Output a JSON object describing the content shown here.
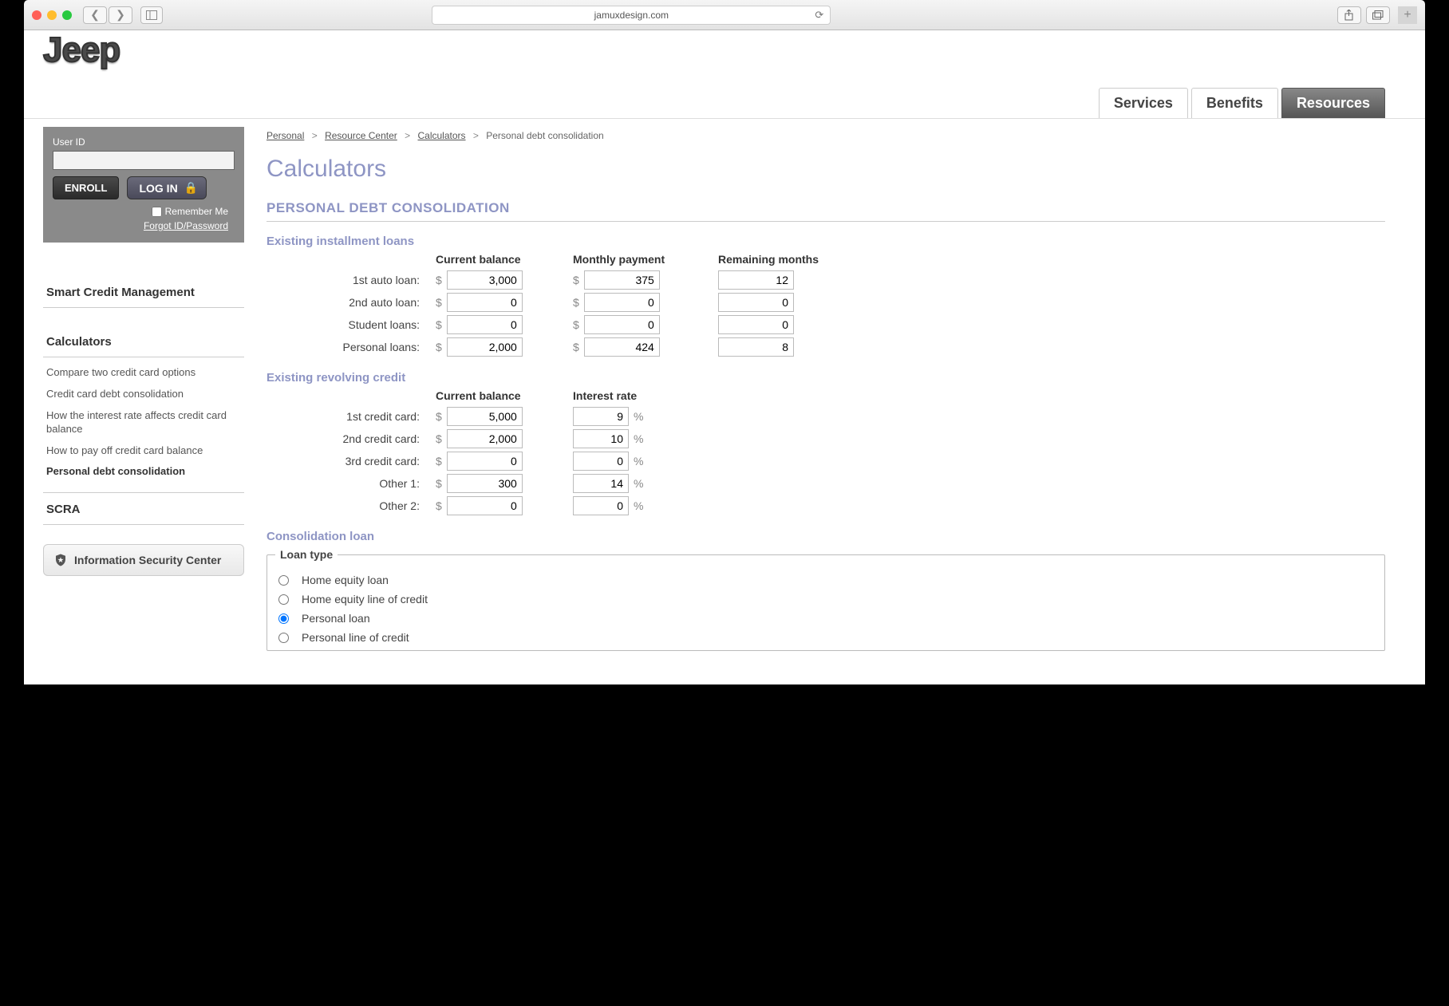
{
  "browser": {
    "url": "jamuxdesign.com"
  },
  "logo_text": "Jeep",
  "top_tabs": {
    "services": "Services",
    "benefits": "Benefits",
    "resources": "Resources"
  },
  "login": {
    "user_id_label": "User ID",
    "enroll": "ENROLL",
    "login": "LOG IN",
    "remember": "Remember Me",
    "forgot": "Forgot ID/Password"
  },
  "sidebar": {
    "smart_credit": "Smart Credit Management",
    "calculators_title": "Calculators",
    "links": [
      "Compare two credit card options",
      "Credit card debt consolidation",
      "How the interest rate affects credit card balance",
      "How to pay off credit card balance",
      "Personal debt consolidation"
    ],
    "scra": "SCRA",
    "isc": "Information Security Center"
  },
  "breadcrumb": {
    "personal": "Personal",
    "resource_center": "Resource Center",
    "calculators": "Calculators",
    "current": "Personal debt consolidation"
  },
  "page_title": "Calculators",
  "section_heading": "PERSONAL DEBT CONSOLIDATION",
  "installment": {
    "title": "Existing installment loans",
    "cols": {
      "balance": "Current balance",
      "monthly": "Monthly payment",
      "remaining": "Remaining months"
    },
    "rows": [
      {
        "label": "1st auto loan:",
        "balance": "3,000",
        "monthly": "375",
        "remaining": "12"
      },
      {
        "label": "2nd auto loan:",
        "balance": "0",
        "monthly": "0",
        "remaining": "0"
      },
      {
        "label": "Student loans:",
        "balance": "0",
        "monthly": "0",
        "remaining": "0"
      },
      {
        "label": "Personal loans:",
        "balance": "2,000",
        "monthly": "424",
        "remaining": "8"
      }
    ]
  },
  "revolving": {
    "title": "Existing revolving credit",
    "cols": {
      "balance": "Current balance",
      "rate": "Interest rate"
    },
    "rows": [
      {
        "label": "1st credit card:",
        "balance": "5,000",
        "rate": "9"
      },
      {
        "label": "2nd credit card:",
        "balance": "2,000",
        "rate": "10"
      },
      {
        "label": "3rd credit card:",
        "balance": "0",
        "rate": "0"
      },
      {
        "label": "Other 1:",
        "balance": "300",
        "rate": "14"
      },
      {
        "label": "Other 2:",
        "balance": "0",
        "rate": "0"
      }
    ]
  },
  "consolidation": {
    "title": "Consolidation loan",
    "legend": "Loan type",
    "options": [
      "Home equity loan",
      "Home equity line of credit",
      "Personal loan",
      "Personal line of credit"
    ],
    "selected_index": 2
  },
  "symbols": {
    "dollar": "$",
    "percent": "%",
    "gt": ">"
  }
}
